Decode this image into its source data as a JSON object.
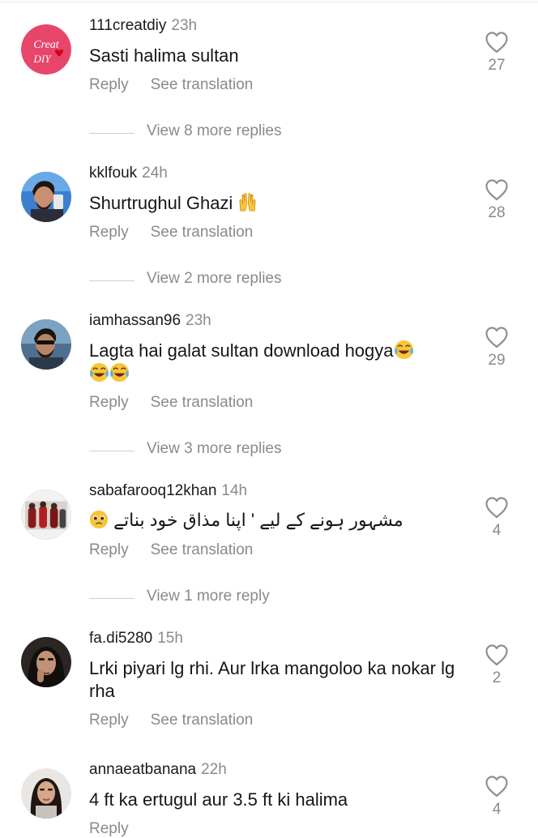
{
  "colors": {
    "meta_gray": "#8a8a8a",
    "text": "#161616",
    "heart_stroke": "#8f8f8f"
  },
  "comments": [
    {
      "username": "111creatdiy",
      "time": "23h",
      "avatar": {
        "type": "logo",
        "line1": "Creat",
        "line2": "DIY",
        "color": "#e8456b"
      },
      "text": "Sasti halima sultan",
      "reply_label": "Reply",
      "translate_label": "See translation",
      "likes": "27",
      "more_replies": "View 8 more replies"
    },
    {
      "username": "kklfouk",
      "time": "24h",
      "avatar": {
        "type": "photo"
      },
      "text": "Shurtrughul Ghazi",
      "emoji": "raising-hands-icon",
      "reply_label": "Reply",
      "translate_label": "See translation",
      "likes": "28",
      "more_replies": "View 2 more replies"
    },
    {
      "username": "iamhassan96",
      "time": "23h",
      "avatar": {
        "type": "photo"
      },
      "text": "Lagta hai galat sultan download hogya",
      "emoji": "tears-of-joy-icon",
      "reply_label": "Reply",
      "translate_label": "See translation",
      "likes": "29",
      "more_replies": "View 3 more replies"
    },
    {
      "username": "sabafarooq12khan",
      "time": "14h",
      "avatar": {
        "type": "photo"
      },
      "text": "مشہور ہونے کے لیے ' اپنا مذاق خود بناتے",
      "emoji": "pleading-face-icon",
      "reply_label": "Reply",
      "translate_label": "See translation",
      "likes": "4",
      "more_replies": "View 1 more reply"
    },
    {
      "username": "fa.di5280",
      "time": "15h",
      "avatar": {
        "type": "photo"
      },
      "text": "Lrki piyari lg rhi. Aur lrka mangoloo ka nokar lg rha",
      "reply_label": "Reply",
      "translate_label": "See translation",
      "likes": "2"
    },
    {
      "username": "annaeatbanana",
      "time": "22h",
      "avatar": {
        "type": "photo"
      },
      "text": "4 ft ka ertugul aur 3.5 ft ki halima",
      "reply_label": "Reply",
      "likes": "4"
    }
  ]
}
